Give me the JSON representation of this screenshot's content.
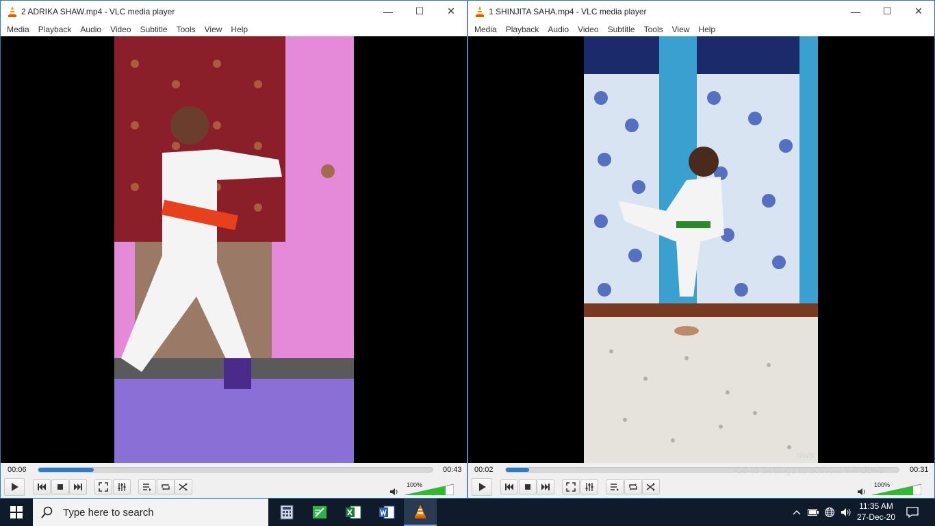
{
  "left_window": {
    "title": "2 ADRIKA SHAW.mp4 - VLC media player",
    "menu": [
      "Media",
      "Playback",
      "Audio",
      "Video",
      "Subtitle",
      "Tools",
      "View",
      "Help"
    ],
    "elapsed": "00:06",
    "duration": "00:43",
    "progress": 0.14,
    "volume": "100%"
  },
  "right_window": {
    "title": "1 SHINJITA SAHA.mp4 - VLC media player",
    "menu": [
      "Media",
      "Playback",
      "Audio",
      "Video",
      "Subtitle",
      "Tools",
      "View",
      "Help"
    ],
    "elapsed": "00:02",
    "duration": "00:31",
    "progress": 0.06,
    "volume": "100%",
    "watermark_line1": "ows",
    "watermark_line2": "Go to Settings to activate Windows."
  },
  "taskbar": {
    "search_placeholder": "Type here to search",
    "apps": [
      "calculator-icon",
      "notepad-icon",
      "excel-icon",
      "word-icon",
      "vlc-icon"
    ],
    "time": "11:35 AM",
    "date": "27-Dec-20"
  },
  "colors": {
    "accent": "#2a7bd3",
    "vlc_orange": "#f08a00",
    "volume_green": "#2cbc2c"
  }
}
